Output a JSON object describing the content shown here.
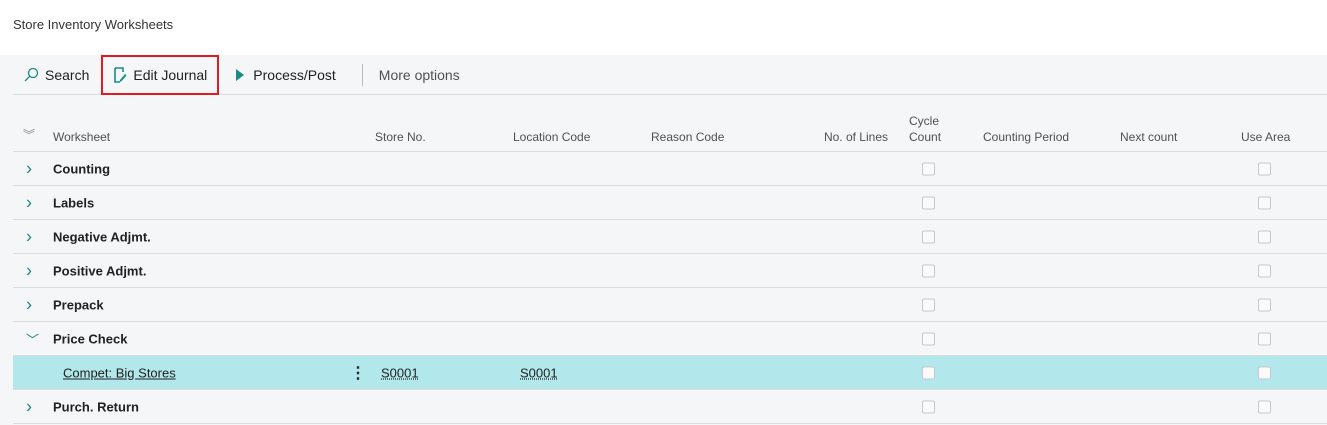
{
  "page": {
    "title": "Store Inventory Worksheets"
  },
  "toolbar": {
    "search": "Search",
    "edit_journal": "Edit Journal",
    "process_post": "Process/Post",
    "more_options": "More options"
  },
  "columns": {
    "worksheet": "Worksheet",
    "store_no": "Store No.",
    "location_code": "Location Code",
    "reason_code": "Reason Code",
    "no_of_lines": "No. of Lines",
    "cycle_count_1": "Cycle",
    "cycle_count_2": "Count",
    "counting_period": "Counting Period",
    "next_count": "Next count",
    "use_area": "Use Area"
  },
  "rows": [
    {
      "name": "Counting",
      "expanded": false
    },
    {
      "name": "Labels",
      "expanded": false
    },
    {
      "name": "Negative Adjmt.",
      "expanded": false
    },
    {
      "name": "Positive Adjmt.",
      "expanded": false
    },
    {
      "name": "Prepack",
      "expanded": false
    },
    {
      "name": "Price Check",
      "expanded": true
    },
    {
      "name": "Compet: Big Stores",
      "store_no": "S0001",
      "location_code": "S0001",
      "selected": true
    },
    {
      "name": "Purch. Return",
      "expanded": false
    }
  ],
  "colors": {
    "accent": "#1a8a88",
    "selected": "#b2e8eb",
    "highlight": "#e21a22"
  }
}
